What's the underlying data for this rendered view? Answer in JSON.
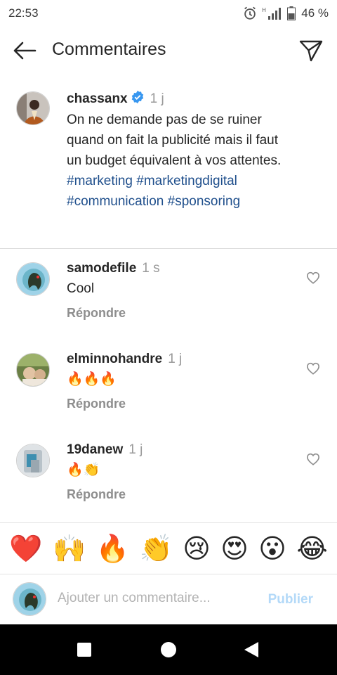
{
  "status": {
    "time": "22:53",
    "battery": "46 %"
  },
  "header": {
    "title": "Commentaires"
  },
  "caption": {
    "username": "chassanx",
    "time": "1 j",
    "text": "On ne demande pas de se ruiner quand on fait la publicité mais il faut un budget équivalent à vos attentes.",
    "hashtags": "#marketing #marketingdigital #communication #sponsoring"
  },
  "comments": [
    {
      "username": "samodefile",
      "time": "1 s",
      "text": "Cool",
      "reply": "Répondre"
    },
    {
      "username": "elminnohandre",
      "time": "1 j",
      "text": "🔥🔥🔥",
      "reply": "Répondre"
    },
    {
      "username": "19danew",
      "time": "1 j",
      "text": "🔥👏",
      "reply": "Répondre"
    }
  ],
  "emoji_bar": [
    "❤️",
    "🙌",
    "🔥",
    "👏",
    "😢",
    "😍",
    "😮",
    "😂"
  ],
  "composer": {
    "placeholder": "Ajouter un commentaire...",
    "publish": "Publier"
  },
  "colors": {
    "link": "#1f4f8c",
    "verified": "#3897f0",
    "publish_disabled": "#b3d9f8",
    "muted": "#8e8e8e"
  },
  "icons": [
    "back-arrow-icon",
    "send-icon",
    "verified-icon",
    "heart-icon",
    "alarm-icon",
    "signal-icon",
    "battery-icon",
    "nav-back-icon",
    "nav-home-icon",
    "nav-recent-icon"
  ]
}
